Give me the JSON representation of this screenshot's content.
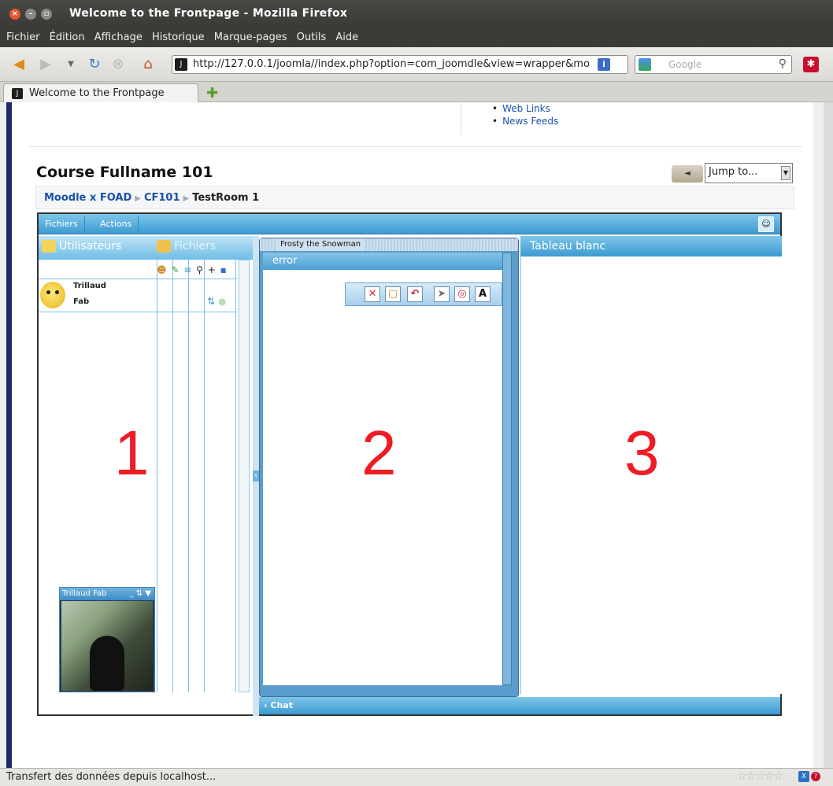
{
  "window": {
    "title": "Welcome to the Frontpage - Mozilla Firefox"
  },
  "menu": [
    "Fichier",
    "Édition",
    "Affichage",
    "Historique",
    "Marque-pages",
    "Outils",
    "Aide"
  ],
  "navbar": {
    "url": "http://127.0.0.1/joomla//index.php?option=com_joomdle&view=wrapper&mo",
    "search_placeholder": "Google"
  },
  "tabs": [
    {
      "label": "Welcome to the Frontpage"
    }
  ],
  "page": {
    "links": [
      "Web Links",
      "News Feeds"
    ],
    "course_title": "Course Fullname 101",
    "jump_to": "Jump to...",
    "breadcrumb": [
      "Moodle x FOAD",
      "CF101",
      "TestRoom 1"
    ]
  },
  "app": {
    "top_tabs": [
      "Fichiers",
      "Actions"
    ],
    "panel1": {
      "tab_users": "Utilisateurs",
      "tab_files": "Fichiers",
      "user_first": "Trillaud",
      "user_last": "Fab",
      "cam_label": "Trillaud Fab"
    },
    "panel2": {
      "window_title": "Frosty the Snowman",
      "header": "error"
    },
    "panel3": {
      "header": "Tableau blanc"
    },
    "chat_label": "Chat",
    "numbers": [
      "1",
      "2",
      "3"
    ]
  },
  "status": {
    "text": "Transfert des données depuis localhost..."
  },
  "colors": {
    "accent": "#3c9ad0",
    "number_red": "#ee1c25",
    "link": "#1a52a8"
  }
}
